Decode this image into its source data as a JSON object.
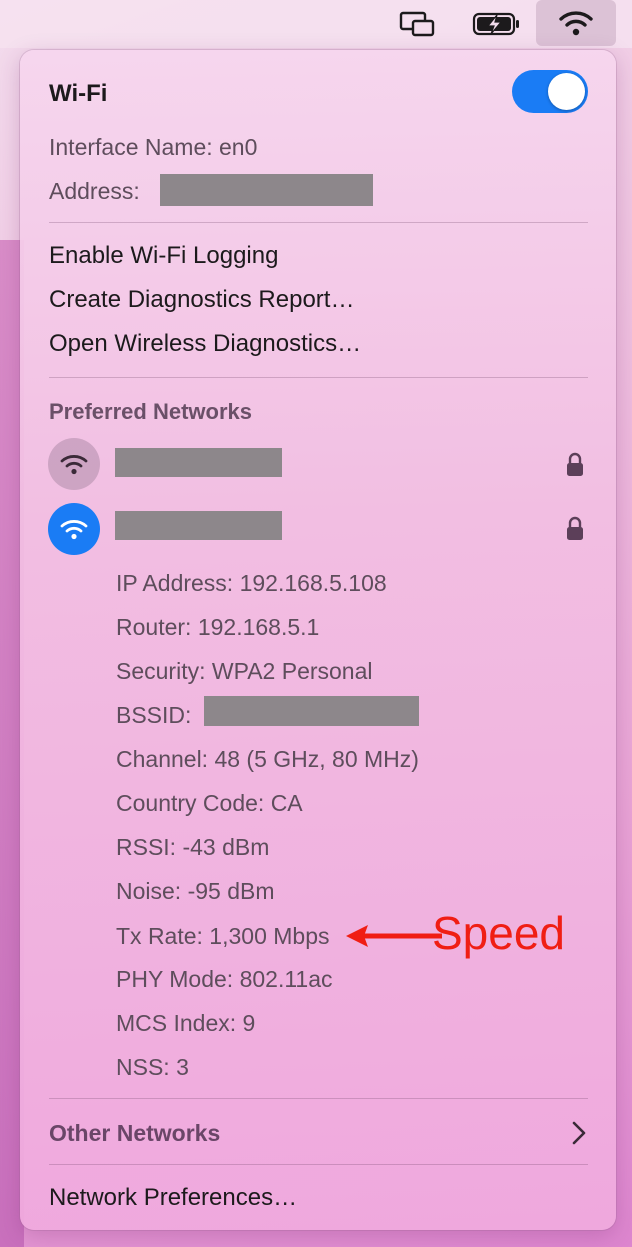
{
  "menubar": {
    "icons": [
      "screen-mirroring-icon",
      "battery-charging-icon",
      "wifi-icon"
    ]
  },
  "wifi": {
    "title": "Wi-Fi",
    "toggle_on": true,
    "interface_name": "Interface Name: en0",
    "address_label": "Address:"
  },
  "menu": {
    "items": [
      "Enable Wi-Fi Logging",
      "Create Diagnostics Report…",
      "Open Wireless Diagnostics…"
    ]
  },
  "preferred": {
    "label": "Preferred Networks",
    "networks": [
      {
        "active": false,
        "locked": true
      },
      {
        "active": true,
        "locked": true
      }
    ],
    "details": {
      "ip": "IP Address: 192.168.5.108",
      "router": "Router: 192.168.5.1",
      "security": "Security: WPA2 Personal",
      "bssid_label": "BSSID:",
      "channel": "Channel: 48 (5 GHz, 80 MHz)",
      "country": "Country Code: CA",
      "rssi": "RSSI: -43 dBm",
      "noise": "Noise: -95 dBm",
      "tx_rate": "Tx Rate: 1,300 Mbps",
      "phy": "PHY Mode: 802.11ac",
      "mcs": "MCS Index: 9",
      "nss": "NSS: 3"
    }
  },
  "other_networks": "Other Networks",
  "network_preferences": "Network Preferences…",
  "annotation": {
    "text": "Speed",
    "color": "#f01e14"
  },
  "colors": {
    "accent": "#1a7cf5"
  }
}
